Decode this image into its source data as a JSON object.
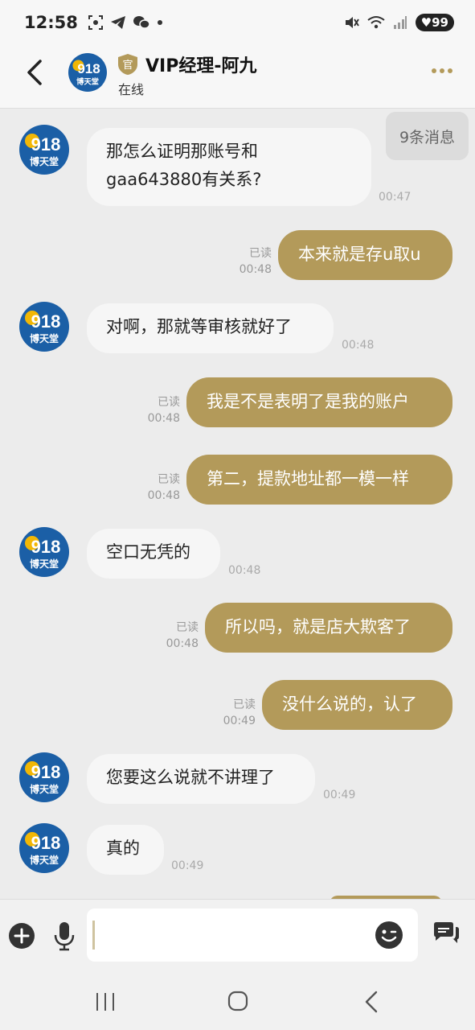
{
  "status_bar": {
    "time": "12:58",
    "battery": "99"
  },
  "header": {
    "title": "VIP经理-阿九",
    "official_badge": "官",
    "status": "在线",
    "avatar_text_top": "918",
    "avatar_text_bottom": "博天堂"
  },
  "chat": {
    "unread_pill": "9条消息",
    "avatar_text_top": "918",
    "avatar_text_bottom": "博天堂",
    "messages": [
      {
        "dir": "in",
        "lines": [
          "那怎么证明那账号和",
          "gaa643880有关系?"
        ],
        "time": "00:47"
      },
      {
        "dir": "out",
        "text": "本来就是存u取u",
        "read": "已读",
        "time": "00:48"
      },
      {
        "dir": "in",
        "text": "对啊，那就等审核就好了",
        "time": "00:48"
      },
      {
        "dir": "out",
        "text": "我是不是表明了是我的账户",
        "read": "已读",
        "time": "00:48"
      },
      {
        "dir": "out",
        "text": "第二，提款地址都一模一样",
        "read": "已读",
        "time": "00:48"
      },
      {
        "dir": "in",
        "text": "空口无凭的",
        "time": "00:48"
      },
      {
        "dir": "out",
        "text": "所以吗，就是店大欺客了",
        "read": "已读",
        "time": "00:48"
      },
      {
        "dir": "out",
        "text": "没什么说的，认了",
        "read": "已读",
        "time": "00:49"
      },
      {
        "dir": "in",
        "text": "您要这么说就不讲理了",
        "time": "00:49"
      },
      {
        "dir": "in",
        "text": "真的",
        "time": "00:49"
      }
    ]
  },
  "input": {
    "placeholder": "",
    "value": ""
  },
  "colors": {
    "accent": "#b39a5a",
    "background": "#ececec",
    "bubble_in": "#f6f6f6"
  }
}
